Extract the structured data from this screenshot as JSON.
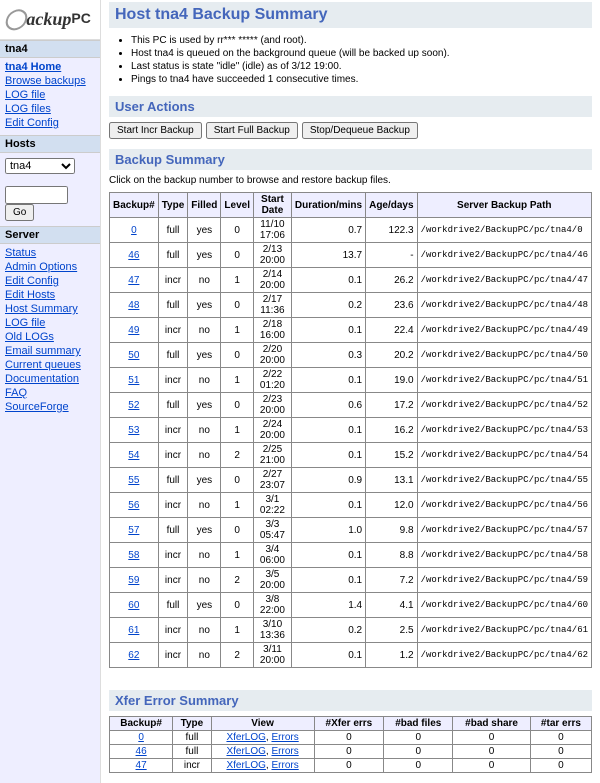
{
  "logo": {
    "brand": "ackup",
    "suffix": "PC"
  },
  "sections": {
    "host": "tna4",
    "hostLinks": [
      "tna4 Home",
      "Browse backups",
      "LOG file",
      "LOG files",
      "Edit Config"
    ],
    "hostsTitle": "Hosts",
    "go": "Go",
    "serverTitle": "Server",
    "serverLinks": [
      "Status",
      "Admin Options",
      "Edit Config",
      "Edit Hosts",
      "Host Summary",
      "LOG file",
      "Old LOGs",
      "Email summary",
      "Current queues",
      "Documentation",
      "FAQ",
      "SourceForge"
    ]
  },
  "header": {
    "title": "Host tna4 Backup Summary",
    "bullets": [
      "This PC is used by rr*** ***** (and root).",
      "Host tna4 is queued on the background queue (will be backed up soon).",
      "Last status is state \"idle\" (idle) as of 3/12 19:00.",
      "Pings to tna4 have succeeded 1 consecutive times."
    ],
    "userActions": "User Actions",
    "buttons": [
      "Start Incr Backup",
      "Start Full Backup",
      "Stop/Dequeue Backup"
    ],
    "backupSummary": "Backup Summary",
    "note": "Click on the backup number to browse and restore backup files.",
    "xfer": "Xfer Error Summary"
  },
  "table": {
    "head": [
      "Backup#",
      "Type",
      "Filled",
      "Level",
      "Start Date",
      "Duration/mins",
      "Age/days",
      "Server Backup Path"
    ],
    "rows": [
      [
        "0",
        "full",
        "yes",
        "0",
        "11/10 17:06",
        "0.7",
        "122.3",
        "/workdrive2/BackupPC/pc/tna4/0"
      ],
      [
        "46",
        "full",
        "yes",
        "0",
        "2/13 20:00",
        "13.7",
        "-",
        "/workdrive2/BackupPC/pc/tna4/46"
      ],
      [
        "47",
        "incr",
        "no",
        "1",
        "2/14 20:00",
        "0.1",
        "26.2",
        "/workdrive2/BackupPC/pc/tna4/47"
      ],
      [
        "48",
        "full",
        "yes",
        "0",
        "2/17 11:36",
        "0.2",
        "23.6",
        "/workdrive2/BackupPC/pc/tna4/48"
      ],
      [
        "49",
        "incr",
        "no",
        "1",
        "2/18 16:00",
        "0.1",
        "22.4",
        "/workdrive2/BackupPC/pc/tna4/49"
      ],
      [
        "50",
        "full",
        "yes",
        "0",
        "2/20 20:00",
        "0.3",
        "20.2",
        "/workdrive2/BackupPC/pc/tna4/50"
      ],
      [
        "51",
        "incr",
        "no",
        "1",
        "2/22 01:20",
        "0.1",
        "19.0",
        "/workdrive2/BackupPC/pc/tna4/51"
      ],
      [
        "52",
        "full",
        "yes",
        "0",
        "2/23 20:00",
        "0.6",
        "17.2",
        "/workdrive2/BackupPC/pc/tna4/52"
      ],
      [
        "53",
        "incr",
        "no",
        "1",
        "2/24 20:00",
        "0.1",
        "16.2",
        "/workdrive2/BackupPC/pc/tna4/53"
      ],
      [
        "54",
        "incr",
        "no",
        "2",
        "2/25 21:00",
        "0.1",
        "15.2",
        "/workdrive2/BackupPC/pc/tna4/54"
      ],
      [
        "55",
        "full",
        "yes",
        "0",
        "2/27 23:07",
        "0.9",
        "13.1",
        "/workdrive2/BackupPC/pc/tna4/55"
      ],
      [
        "56",
        "incr",
        "no",
        "1",
        "3/1 02:22",
        "0.1",
        "12.0",
        "/workdrive2/BackupPC/pc/tna4/56"
      ],
      [
        "57",
        "full",
        "yes",
        "0",
        "3/3 05:47",
        "1.0",
        "9.8",
        "/workdrive2/BackupPC/pc/tna4/57"
      ],
      [
        "58",
        "incr",
        "no",
        "1",
        "3/4 06:00",
        "0.1",
        "8.8",
        "/workdrive2/BackupPC/pc/tna4/58"
      ],
      [
        "59",
        "incr",
        "no",
        "2",
        "3/5 20:00",
        "0.1",
        "7.2",
        "/workdrive2/BackupPC/pc/tna4/59"
      ],
      [
        "60",
        "full",
        "yes",
        "0",
        "3/8 22:00",
        "1.4",
        "4.1",
        "/workdrive2/BackupPC/pc/tna4/60"
      ],
      [
        "61",
        "incr",
        "no",
        "1",
        "3/10 13:36",
        "0.2",
        "2.5",
        "/workdrive2/BackupPC/pc/tna4/61"
      ],
      [
        "62",
        "incr",
        "no",
        "2",
        "3/11 20:00",
        "0.1",
        "1.2",
        "/workdrive2/BackupPC/pc/tna4/62"
      ]
    ]
  },
  "xferTable": {
    "head": [
      "Backup#",
      "Type",
      "View",
      "#Xfer errs",
      "#bad files",
      "#bad share",
      "#tar errs"
    ],
    "rows": [
      [
        "0",
        "full",
        [
          "XferLOG",
          "Errors"
        ],
        "0",
        "0",
        "0",
        "0"
      ],
      [
        "46",
        "full",
        [
          "XferLOG",
          "Errors"
        ],
        "0",
        "0",
        "0",
        "0"
      ],
      [
        "47",
        "incr",
        [
          "XferLOG",
          "Errors"
        ],
        "0",
        "0",
        "0",
        "0"
      ]
    ]
  }
}
